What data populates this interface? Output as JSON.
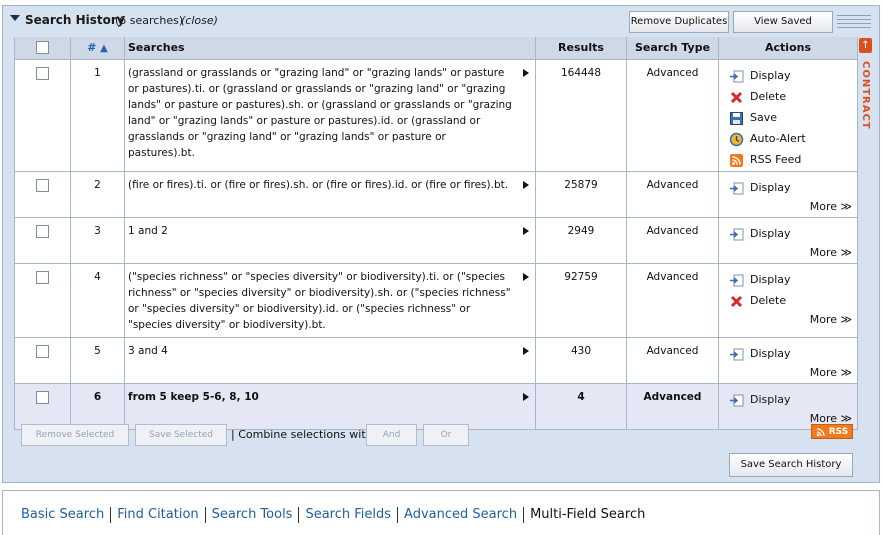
{
  "panel": {
    "title": "Search History",
    "count": "(6 searches)",
    "close": "(close)",
    "remove_duplicates": "Remove Duplicates",
    "view_saved": "View Saved"
  },
  "table": {
    "headers": {
      "num": "#",
      "sort_indicator": "▲",
      "searches": "Searches",
      "results": "Results",
      "search_type": "Search Type",
      "actions": "Actions"
    },
    "rows": [
      {
        "num": "1",
        "query": "(grassland or grasslands or \"grazing land\" or \"grazing lands\" or pasture or pastures).ti. or (grassland or grasslands or \"grazing land\" or \"grazing lands\" or pasture or pastures).sh. or (grassland or grasslands or \"grazing land\" or \"grazing lands\" or pasture or pastures).id. or (grassland or grasslands or \"grazing land\" or \"grazing lands\" or pasture or pastures).bt.",
        "results": "164448",
        "type": "Advanced"
      },
      {
        "num": "2",
        "query": "(fire or fires).ti. or (fire or fires).sh. or (fire or fires).id. or (fire or fires).bt.",
        "results": "25879",
        "type": "Advanced"
      },
      {
        "num": "3",
        "query": "1 and 2",
        "results": "2949",
        "type": "Advanced"
      },
      {
        "num": "4",
        "query": "(\"species richness\" or \"species diversity\" or biodiversity).ti. or (\"species richness\" or \"species diversity\" or biodiversity).sh. or (\"species richness\" or \"species diversity\" or biodiversity).id. or (\"species richness\" or \"species diversity\" or biodiversity).bt.",
        "results": "92759",
        "type": "Advanced"
      },
      {
        "num": "5",
        "query": "3 and 4",
        "results": "430",
        "type": "Advanced"
      },
      {
        "num": "6",
        "query": "from 5 keep 5-6, 8, 10",
        "results": "4",
        "type": "Advanced"
      }
    ],
    "actions": {
      "display": "Display",
      "delete": "Delete",
      "save": "Save",
      "auto_alert": "Auto-Alert",
      "rss_feed": "RSS Feed",
      "more": "More ≫"
    }
  },
  "side": {
    "contract": "CONTRACT",
    "arrow": "↑"
  },
  "footer": {
    "remove_selected": "Remove Selected",
    "save_selected": "Save Selected",
    "combine_label": "| Combine selections with:",
    "and": "And",
    "or": "Or",
    "rss": "RSS",
    "save_history": "Save Search History"
  },
  "nav": {
    "links": [
      "Basic Search",
      "Find Citation",
      "Search Tools",
      "Search Fields",
      "Advanced Search",
      "Multi-Field Search"
    ]
  },
  "colors": {
    "panel_bg": "#d6e2f0",
    "header_bg": "#cfd8e6",
    "selected_row": "#e6e7f4",
    "link": "#1f5f9e",
    "contract": "#d9501e",
    "rss": "#f07a1c"
  }
}
